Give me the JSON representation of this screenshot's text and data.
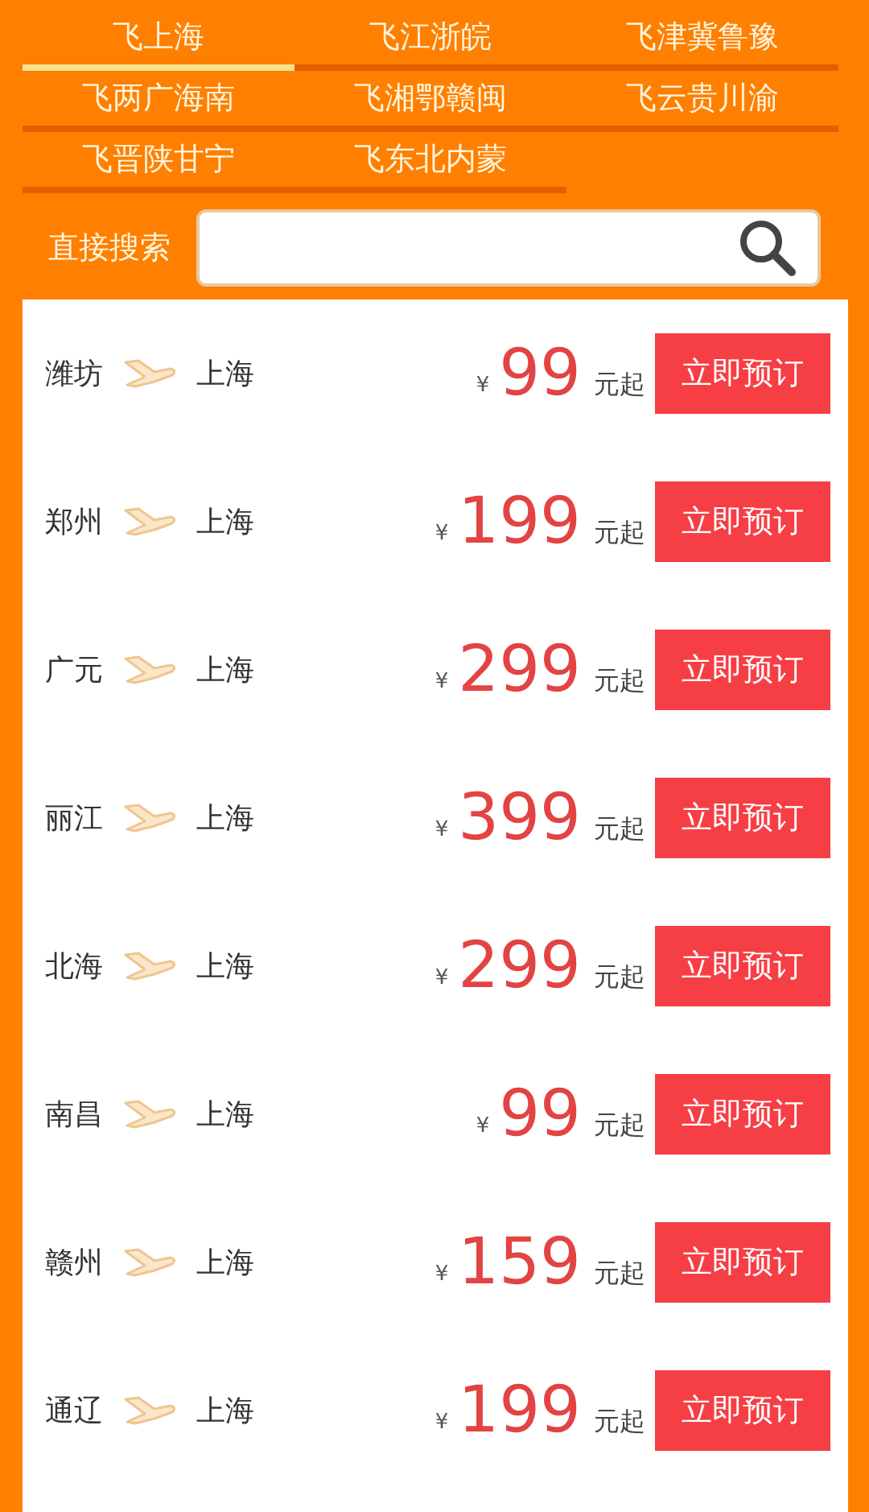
{
  "tabs": [
    {
      "label": "飞上海",
      "selected": true
    },
    {
      "label": "飞江浙皖",
      "selected": false
    },
    {
      "label": "飞津冀鲁豫",
      "selected": false
    },
    {
      "label": "飞两广海南",
      "selected": false
    },
    {
      "label": "飞湘鄂赣闽",
      "selected": false
    },
    {
      "label": "飞云贵川渝",
      "selected": false
    },
    {
      "label": "飞晋陕甘宁",
      "selected": false
    },
    {
      "label": "飞东北内蒙",
      "selected": false
    }
  ],
  "search": {
    "label": "直接搜索"
  },
  "flights": [
    {
      "from": "潍坊",
      "to": "上海",
      "currency": "¥",
      "price": "99",
      "unit": "元起",
      "button": "立即预订"
    },
    {
      "from": "郑州",
      "to": "上海",
      "currency": "¥",
      "price": "199",
      "unit": "元起",
      "button": "立即预订"
    },
    {
      "from": "广元",
      "to": "上海",
      "currency": "¥",
      "price": "299",
      "unit": "元起",
      "button": "立即预订"
    },
    {
      "from": "丽江",
      "to": "上海",
      "currency": "¥",
      "price": "399",
      "unit": "元起",
      "button": "立即预订"
    },
    {
      "from": "北海",
      "to": "上海",
      "currency": "¥",
      "price": "299",
      "unit": "元起",
      "button": "立即预订"
    },
    {
      "from": "南昌",
      "to": "上海",
      "currency": "¥",
      "price": "99",
      "unit": "元起",
      "button": "立即预订"
    },
    {
      "from": "赣州",
      "to": "上海",
      "currency": "¥",
      "price": "159",
      "unit": "元起",
      "button": "立即预订"
    },
    {
      "from": "通辽",
      "to": "上海",
      "currency": "¥",
      "price": "199",
      "unit": "元起",
      "button": "立即预订"
    }
  ]
}
